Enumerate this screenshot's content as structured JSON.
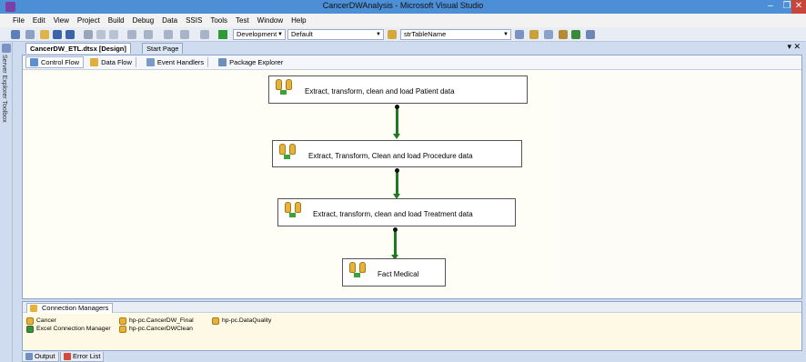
{
  "window": {
    "title": "CancerDWAnalysis - Microsoft Visual Studio",
    "minimize_glyph": "–",
    "maximize_glyph": "❐",
    "close_glyph": "✕"
  },
  "menu": [
    "File",
    "Edit",
    "View",
    "Project",
    "Build",
    "Debug",
    "Data",
    "SSIS",
    "Tools",
    "Test",
    "Window",
    "Help"
  ],
  "toolbar": {
    "config_dropdown": "Development",
    "platform_dropdown": "Default",
    "find_dropdown": "strTableName"
  },
  "left_strip": {
    "label": "Server Explorer  Toolbox"
  },
  "document_tabs": {
    "active": "CancerDW_ETL.dtsx [Design]",
    "inactive": "Start Page",
    "pin_close": "▾ ✕"
  },
  "designer_tabs": [
    "Control Flow",
    "Data Flow",
    "Event Handlers",
    "Package Explorer"
  ],
  "tasks": [
    {
      "label": "Extract, transform, clean and load Patient data"
    },
    {
      "label": "Extract, Transform, Clean and load Procedure data"
    },
    {
      "label": "Extract, transform, clean and load Treatment data"
    },
    {
      "label": "Fact Medical"
    }
  ],
  "connection_managers": {
    "tab_label": "Connection Managers",
    "items": [
      "Cancer",
      "hp-pc.CancerDW_Final",
      "hp-pc.DataQuality",
      "Excel Connection Manager",
      "hp-pc.CancerDWClean"
    ]
  },
  "bottom_tabs": [
    "Output",
    "Error List"
  ],
  "colors": {
    "titlebar": "#4c8fd6",
    "connector": "#1f7a1f",
    "task_icon": "#e8b23a"
  }
}
